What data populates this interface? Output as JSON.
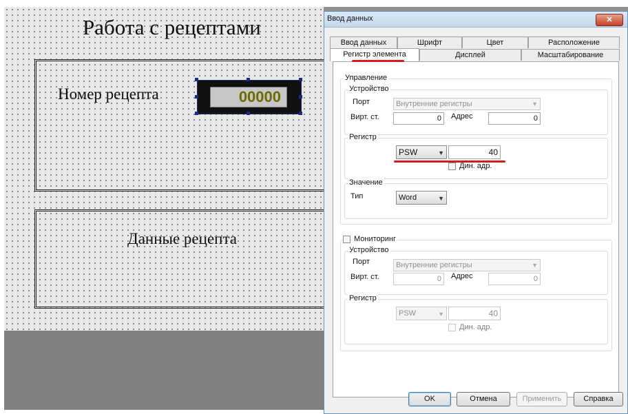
{
  "canvas": {
    "title": "Работа с рецептами",
    "recipe_number_label": "Номер рецепта",
    "recipe_number_value": "00000",
    "recipe_data_label": "Данные рецепта"
  },
  "dialog": {
    "title": "Ввод данных",
    "close_label": "✕",
    "tabs_row1": [
      "Ввод данных",
      "Шрифт",
      "Цвет",
      "Расположение"
    ],
    "tabs_row2": [
      "Регистр элемента",
      "Дисплей",
      "Масштабирование"
    ],
    "active_tab": "Регистр элемента",
    "control": {
      "group_label": "Управление",
      "device_label": "Устройство",
      "port_label": "Порт",
      "port_value": "Внутренние регистры",
      "virt_label": "Вирт. ст.",
      "virt_value": "0",
      "address_label": "Адрес",
      "address_value": "0",
      "register_label": "Регистр",
      "register_type": "PSW",
      "register_value": "40",
      "dyn_addr_label": "Дин. адр.",
      "dyn_addr_checked": false,
      "value_label": "Значение",
      "type_label": "Тип",
      "type_value": "Word"
    },
    "monitoring": {
      "label": "Мониторинг",
      "checked": false,
      "device_label": "Устройство",
      "port_label": "Порт",
      "port_value": "Внутренние регистры",
      "virt_label": "Вирт. ст.",
      "virt_value": "0",
      "address_label": "Адрес",
      "address_value": "0",
      "register_label": "Регистр",
      "register_type": "PSW",
      "register_value": "40",
      "dyn_addr_label": "Дин. адр."
    },
    "buttons": {
      "ok": "OK",
      "cancel": "Отмена",
      "apply": "Применить",
      "help": "Справка"
    }
  },
  "colors": {
    "annotation_underline": "#d51b1b",
    "numeric_display_text": "#6b6b00",
    "selection_handle": "#1a2a8a"
  }
}
